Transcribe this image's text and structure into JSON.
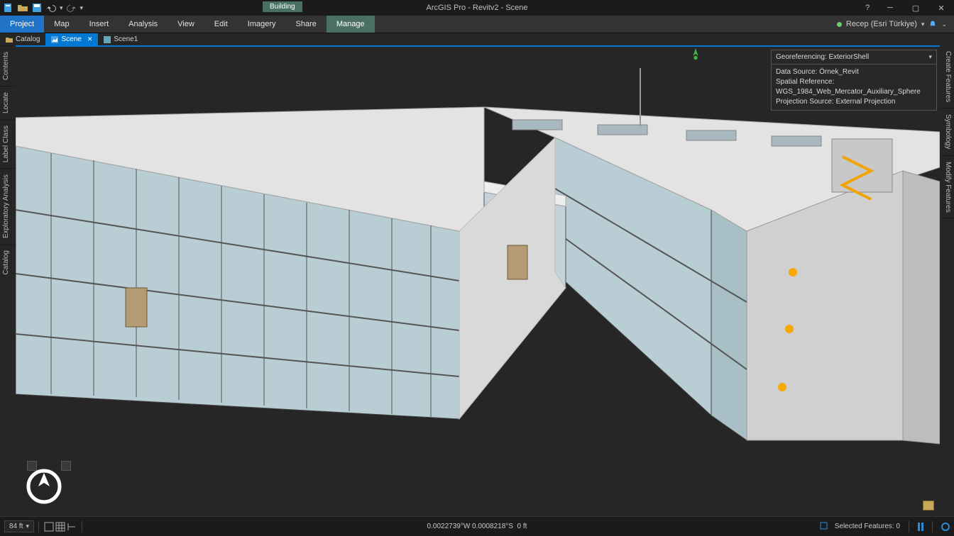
{
  "app": {
    "title": "ArcGIS Pro - Revitv2 - Scene"
  },
  "context_tab": "Building",
  "ribbon": {
    "project": "Project",
    "tabs": [
      "Map",
      "Insert",
      "Analysis",
      "View",
      "Edit",
      "Imagery",
      "Share"
    ],
    "manage": "Manage"
  },
  "user": {
    "name": "Recep (Esri Türkiye)"
  },
  "view_tabs": {
    "catalog": "Catalog",
    "scene": "Scene",
    "scene1": "Scene1"
  },
  "left_sidebar": [
    "Contents",
    "Locate",
    "Label Class",
    "Exploratory Analysis",
    "Catalog"
  ],
  "right_sidebar": [
    "Create Features",
    "Symbology",
    "Modify Features"
  ],
  "info_panel": {
    "title": "Georeferencing: ExteriorShell",
    "line1": "Data Source: Örnek_Revit",
    "line2": "Spatial Reference: WGS_1984_Web_Mercator_Auxiliary_Sphere",
    "line3": "Projection Source: External Projection"
  },
  "statusbar": {
    "scale": "84 ft",
    "coords": "0.0022739°W 0.0008218°S",
    "elev": "0 ft",
    "selected": "Selected Features: 0"
  }
}
